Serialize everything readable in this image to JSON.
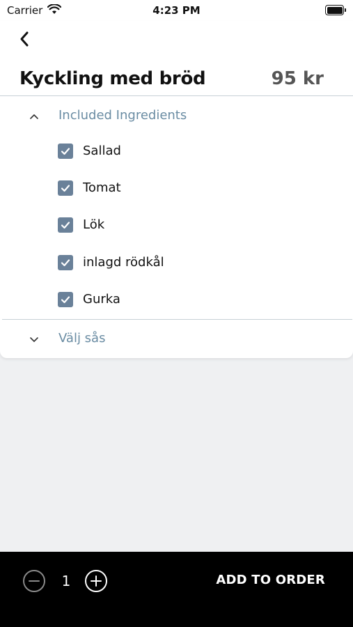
{
  "status_bar": {
    "carrier": "Carrier",
    "time": "4:23 PM",
    "wifi_icon": "wifi-icon",
    "battery_icon": "battery-icon"
  },
  "nav": {
    "back_icon": "chevron-left-icon"
  },
  "product": {
    "name": "Kyckling med bröd",
    "price": "95 kr"
  },
  "sections": {
    "ingredients": {
      "label": "Included Ingredients",
      "expanded": true,
      "icon": "chevron-up-icon",
      "items": [
        {
          "label": "Sallad",
          "checked": true
        },
        {
          "label": "Tomat",
          "checked": true
        },
        {
          "label": "Lök",
          "checked": true
        },
        {
          "label": "inlagd rödkål",
          "checked": true
        },
        {
          "label": "Gurka",
          "checked": true
        }
      ]
    },
    "sauce": {
      "label": "Välj sås",
      "expanded": false,
      "icon": "chevron-down-icon"
    }
  },
  "order_bar": {
    "quantity": "1",
    "minus_icon": "minus-circle-icon",
    "plus_icon": "plus-circle-icon",
    "add_label": "ADD TO ORDER"
  },
  "colors": {
    "accent": "#6a8ca3",
    "checkbox": "#6a8199",
    "bottom_bar": "#000000",
    "background": "#eff0f2"
  }
}
